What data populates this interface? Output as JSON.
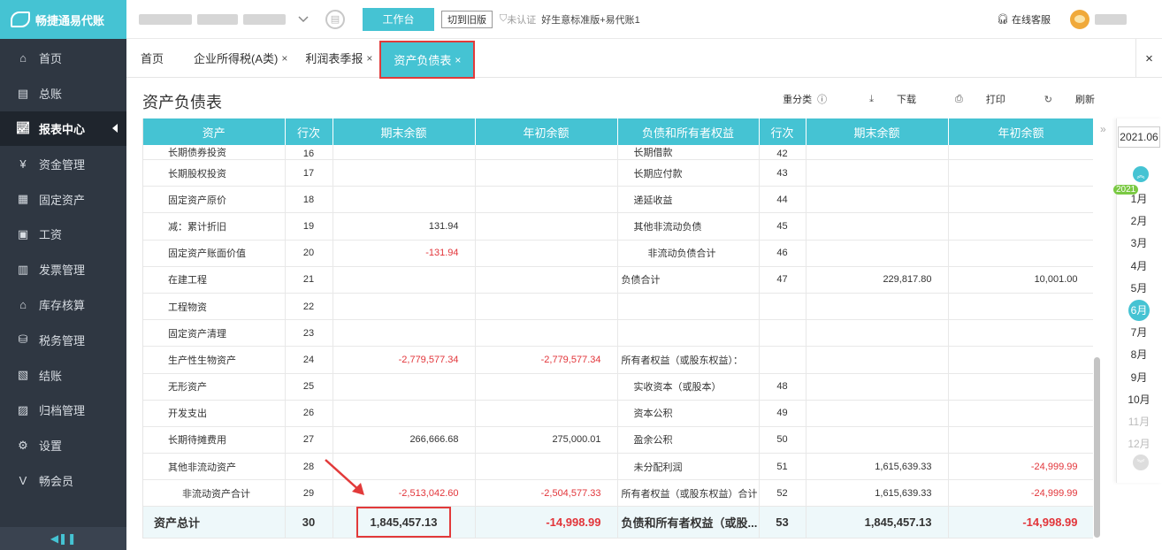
{
  "app": {
    "name": "畅捷通易代账"
  },
  "sidebar": {
    "items": [
      {
        "label": "首页",
        "icon": "home-icon"
      },
      {
        "label": "总账",
        "icon": "ledger-icon"
      },
      {
        "label": "报表中心",
        "icon": "chart-icon",
        "active": true
      },
      {
        "label": "资金管理",
        "icon": "money-icon"
      },
      {
        "label": "固定资产",
        "icon": "building-icon"
      },
      {
        "label": "工资",
        "icon": "salary-icon"
      },
      {
        "label": "发票管理",
        "icon": "invoice-icon"
      },
      {
        "label": "库存核算",
        "icon": "warehouse-icon"
      },
      {
        "label": "税务管理",
        "icon": "tax-icon"
      },
      {
        "label": "结账",
        "icon": "close-books-icon"
      },
      {
        "label": "归档管理",
        "icon": "archive-icon"
      },
      {
        "label": "设置",
        "icon": "gear-icon"
      },
      {
        "label": "畅会员",
        "icon": "vip-icon"
      }
    ]
  },
  "topbar": {
    "workbench": "工作台",
    "switch_old": "切到旧版",
    "unverified": "未认证",
    "version": "好生意标准版+易代账1",
    "support": "在线客服"
  },
  "tabs": [
    {
      "label": "首页",
      "closable": false
    },
    {
      "label": "企业所得税(A类)",
      "closable": true
    },
    {
      "label": "利润表季报",
      "closable": true
    },
    {
      "label": "资产负债表",
      "closable": true,
      "active": true
    }
  ],
  "tab_close_all": "×",
  "page": {
    "title": "资产负债表",
    "actions": {
      "reclassify": "重分类",
      "download": "下载",
      "print": "打印",
      "refresh": "刷新"
    }
  },
  "table": {
    "headers": [
      "资产",
      "行次",
      "期末余额",
      "年初余额",
      "负债和所有者权益",
      "行次",
      "期末余额",
      "年初余额"
    ],
    "partial_row": {
      "a_name": "长期债券投资",
      "a_line": "16",
      "l_name": "长期借款",
      "l_line": "42"
    },
    "rows": [
      {
        "a_name": "长期股权投资",
        "a_line": "17",
        "a_end": "",
        "a_begin": "",
        "l_name": "长期应付款",
        "l_line": "43",
        "l_end": "",
        "l_begin": ""
      },
      {
        "a_name": "固定资产原价",
        "a_line": "18",
        "a_end": "",
        "a_begin": "",
        "l_name": "递延收益",
        "l_line": "44",
        "l_end": "",
        "l_begin": ""
      },
      {
        "a_name": "减：累计折旧",
        "a_line": "19",
        "a_end": "131.94",
        "a_begin": "",
        "l_name": "其他非流动负债",
        "l_line": "45",
        "l_end": "",
        "l_begin": ""
      },
      {
        "a_name": "固定资产账面价值",
        "a_line": "20",
        "a_end": "-131.94",
        "a_begin": "",
        "l_name": "非流动负债合计",
        "l_line": "46",
        "l_end": "",
        "l_begin": "",
        "l_indent": true
      },
      {
        "a_name": "在建工程",
        "a_line": "21",
        "a_end": "",
        "a_begin": "",
        "l_name": "负债合计",
        "l_line": "47",
        "l_end": "229,817.80",
        "l_begin": "10,001.00",
        "l_lvl0": true
      },
      {
        "a_name": "工程物资",
        "a_line": "22",
        "a_end": "",
        "a_begin": "",
        "l_name": "",
        "l_line": "",
        "l_end": "",
        "l_begin": ""
      },
      {
        "a_name": "固定资产清理",
        "a_line": "23",
        "a_end": "",
        "a_begin": "",
        "l_name": "",
        "l_line": "",
        "l_end": "",
        "l_begin": ""
      },
      {
        "a_name": "生产性生物资产",
        "a_line": "24",
        "a_end": "-2,779,577.34",
        "a_begin": "-2,779,577.34",
        "l_name": "所有者权益（或股东权益）：",
        "l_line": "",
        "l_end": "",
        "l_begin": "",
        "l_lvl0": true
      },
      {
        "a_name": "无形资产",
        "a_line": "25",
        "a_end": "",
        "a_begin": "",
        "l_name": "实收资本（或股本）",
        "l_line": "48",
        "l_end": "",
        "l_begin": ""
      },
      {
        "a_name": "开发支出",
        "a_line": "26",
        "a_end": "",
        "a_begin": "",
        "l_name": "资本公积",
        "l_line": "49",
        "l_end": "",
        "l_begin": ""
      },
      {
        "a_name": "长期待摊费用",
        "a_line": "27",
        "a_end": "266,666.68",
        "a_begin": "275,000.01",
        "l_name": "盈余公积",
        "l_line": "50",
        "l_end": "",
        "l_begin": ""
      },
      {
        "a_name": "其他非流动资产",
        "a_line": "28",
        "a_end": "",
        "a_begin": "",
        "l_name": "未分配利润",
        "l_line": "51",
        "l_end": "1,615,639.33",
        "l_begin": "-24,999.99"
      },
      {
        "a_name": "非流动资产合计",
        "a_line": "29",
        "a_end": "-2,513,042.60",
        "a_begin": "-2,504,577.33",
        "l_name": "所有者权益（或股东权益）合计",
        "l_line": "52",
        "l_end": "1,615,639.33",
        "l_begin": "-24,999.99",
        "a_indent": true,
        "l_lvl0": true
      }
    ],
    "total": {
      "a_name": "资产总计",
      "a_line": "30",
      "a_end": "1,845,457.13",
      "a_begin": "-14,998.99",
      "l_name": "负债和所有者权益（或股...",
      "l_line": "53",
      "l_end": "1,845,457.13",
      "l_begin": "-14,998.99"
    }
  },
  "period_panel": {
    "period": "2021.06",
    "year": "2021",
    "months": [
      "1月",
      "2月",
      "3月",
      "4月",
      "5月",
      "6月",
      "7月",
      "8月",
      "9月",
      "10月",
      "11月",
      "12月"
    ],
    "selected_index": 5,
    "disabled_from_index": 10
  }
}
